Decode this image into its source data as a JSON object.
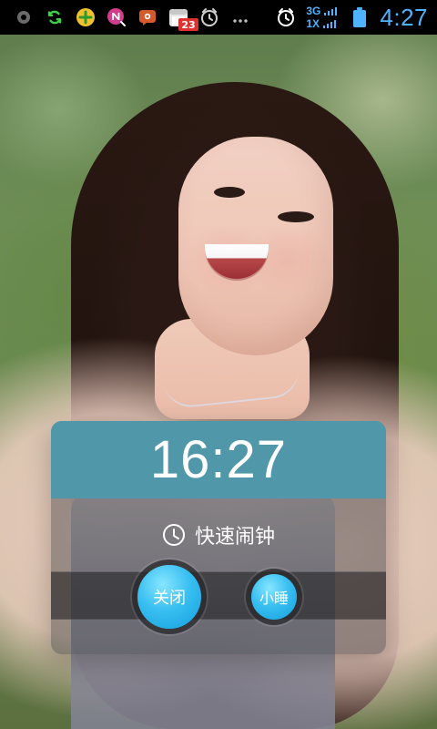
{
  "status_bar": {
    "left_icons": [
      {
        "name": "record-icon"
      },
      {
        "name": "sync-icon"
      },
      {
        "name": "app-icon-plus"
      },
      {
        "name": "notification-n-icon"
      },
      {
        "name": "weibo-icon"
      },
      {
        "name": "calendar-icon",
        "badge": "23"
      },
      {
        "name": "alarm-overlay-icon"
      },
      {
        "name": "more-icon"
      }
    ],
    "right": {
      "alarm_icon": "alarm-clock-icon",
      "signal_top": "3G",
      "signal_bottom": "1X",
      "battery_icon": "battery-icon",
      "time": "4:27"
    }
  },
  "alarm": {
    "time": "16:27",
    "label": "快速闹钟",
    "clock_icon": "clock-icon",
    "buttons": {
      "close": "关闭",
      "snooze": "小睡"
    }
  },
  "colors": {
    "header": "#4f97a9",
    "button": "#39bff1",
    "status_accent": "#4fb3ff"
  }
}
